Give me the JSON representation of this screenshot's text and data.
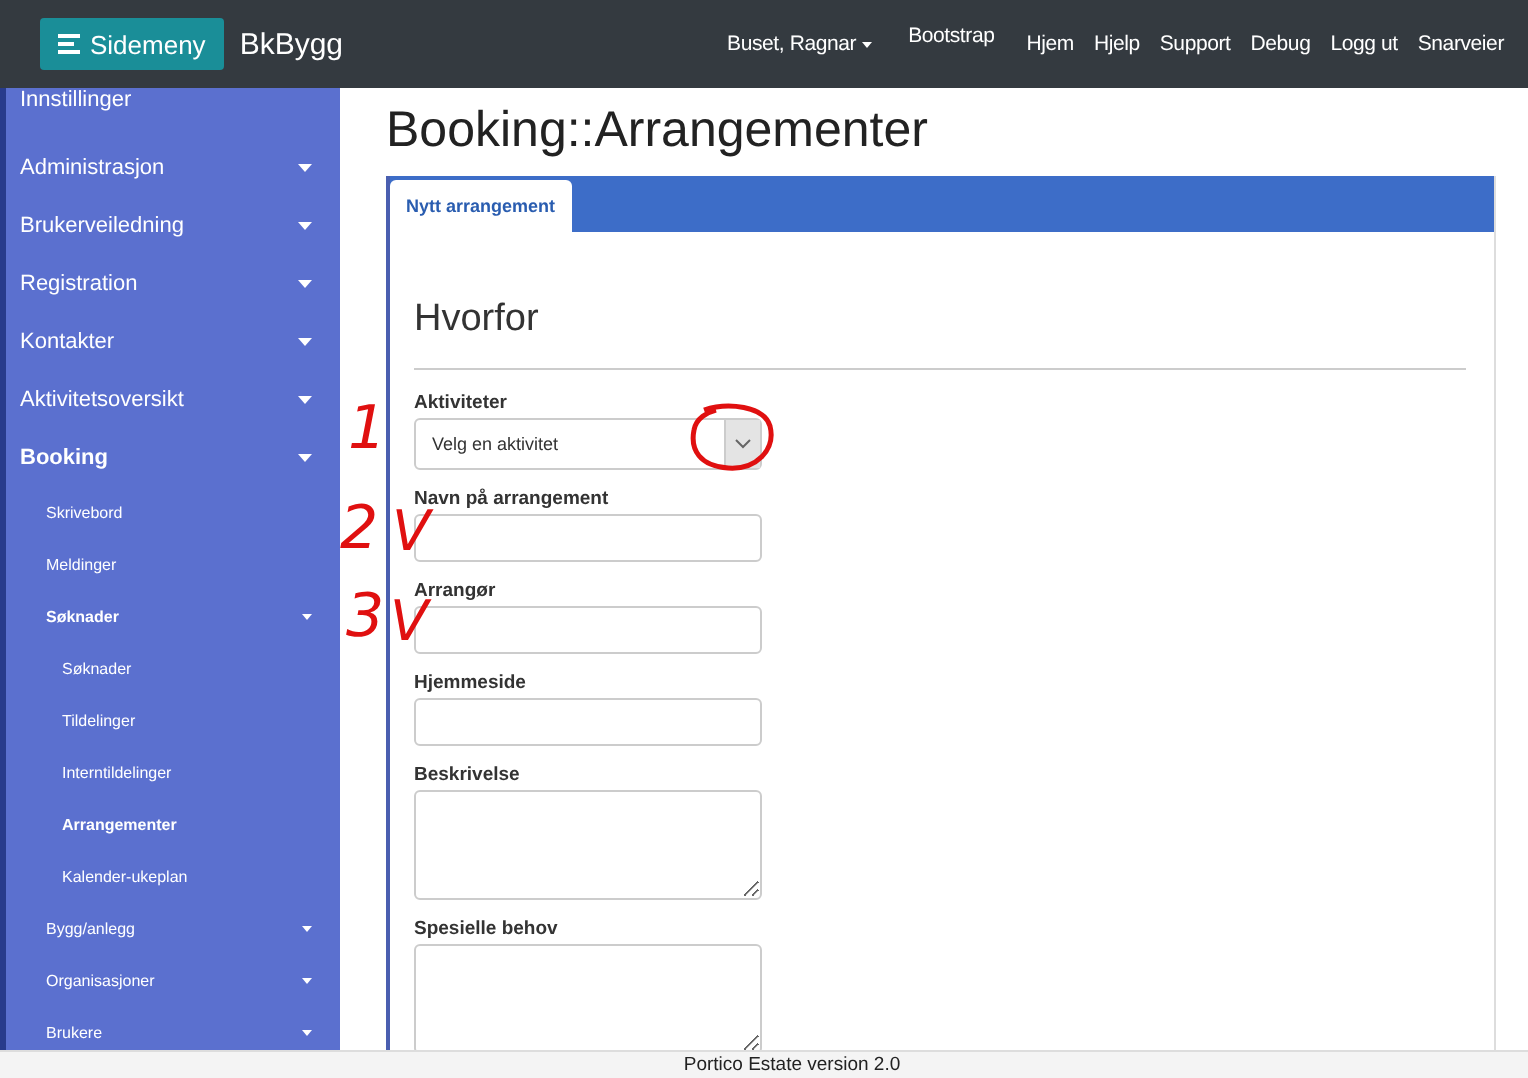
{
  "topbar": {
    "menu_button": "Sidemeny",
    "brand": "BkBygg",
    "links": [
      {
        "label": "Buset, Ragnar",
        "dropdown": true
      },
      {
        "label": "Bootstrap",
        "dropdown": false
      },
      {
        "label": "Hjem",
        "dropdown": false
      },
      {
        "label": "Hjelp",
        "dropdown": false
      },
      {
        "label": "Support",
        "dropdown": false
      },
      {
        "label": "Debug",
        "dropdown": false
      },
      {
        "label": "Logg ut",
        "dropdown": false
      },
      {
        "label": "Snarveier",
        "dropdown": false
      }
    ]
  },
  "sidebar": {
    "items": [
      {
        "label": "Innstillinger",
        "caret": false,
        "selected": false
      },
      {
        "label": "Administrasjon",
        "caret": true,
        "selected": false
      },
      {
        "label": "Brukerveiledning",
        "caret": true,
        "selected": false
      },
      {
        "label": "Registration",
        "caret": true,
        "selected": false
      },
      {
        "label": "Kontakter",
        "caret": true,
        "selected": false
      },
      {
        "label": "Aktivitetsoversikt",
        "caret": true,
        "selected": false
      },
      {
        "label": "Booking",
        "caret": true,
        "selected": true,
        "children": [
          {
            "label": "Skrivebord",
            "caret": false,
            "selected": false
          },
          {
            "label": "Meldinger",
            "caret": false,
            "selected": false
          },
          {
            "label": "Søknader",
            "caret": true,
            "selected": true,
            "children": [
              {
                "label": "Søknader",
                "caret": false,
                "selected": false
              },
              {
                "label": "Tildelinger",
                "caret": false,
                "selected": false
              },
              {
                "label": "Interntildelinger",
                "caret": false,
                "selected": false
              },
              {
                "label": "Arrangementer",
                "caret": false,
                "selected": true
              },
              {
                "label": "Kalender-ukeplan",
                "caret": false,
                "selected": false
              }
            ]
          },
          {
            "label": "Bygg/anlegg",
            "caret": true,
            "selected": false
          },
          {
            "label": "Organisasjoner",
            "caret": true,
            "selected": false
          },
          {
            "label": "Brukere",
            "caret": true,
            "selected": false
          }
        ]
      }
    ]
  },
  "page_title": "Booking::Arrangementer",
  "tabs": [
    {
      "label": "Nytt arrangement",
      "selected": true
    }
  ],
  "section_title": "Hvorfor",
  "fields": [
    {
      "kind": "select",
      "label": "Aktiviteter",
      "value": "Velg en aktivitet"
    },
    {
      "kind": "text",
      "label": "Navn på arrangement"
    },
    {
      "kind": "text",
      "label": "Arrangør"
    },
    {
      "kind": "text",
      "label": "Hjemmeside"
    },
    {
      "kind": "textarea",
      "label": "Beskrivelse"
    },
    {
      "kind": "textarea",
      "label": "Spesielle behov"
    }
  ],
  "annotations": [
    {
      "kind": "text",
      "text": "1"
    },
    {
      "kind": "circle"
    },
    {
      "kind": "text",
      "text": "2"
    },
    {
      "kind": "check",
      "text": "V"
    },
    {
      "kind": "text",
      "text": "3"
    },
    {
      "kind": "check",
      "text": "V"
    }
  ],
  "footer": "Portico Estate version 2.0"
}
